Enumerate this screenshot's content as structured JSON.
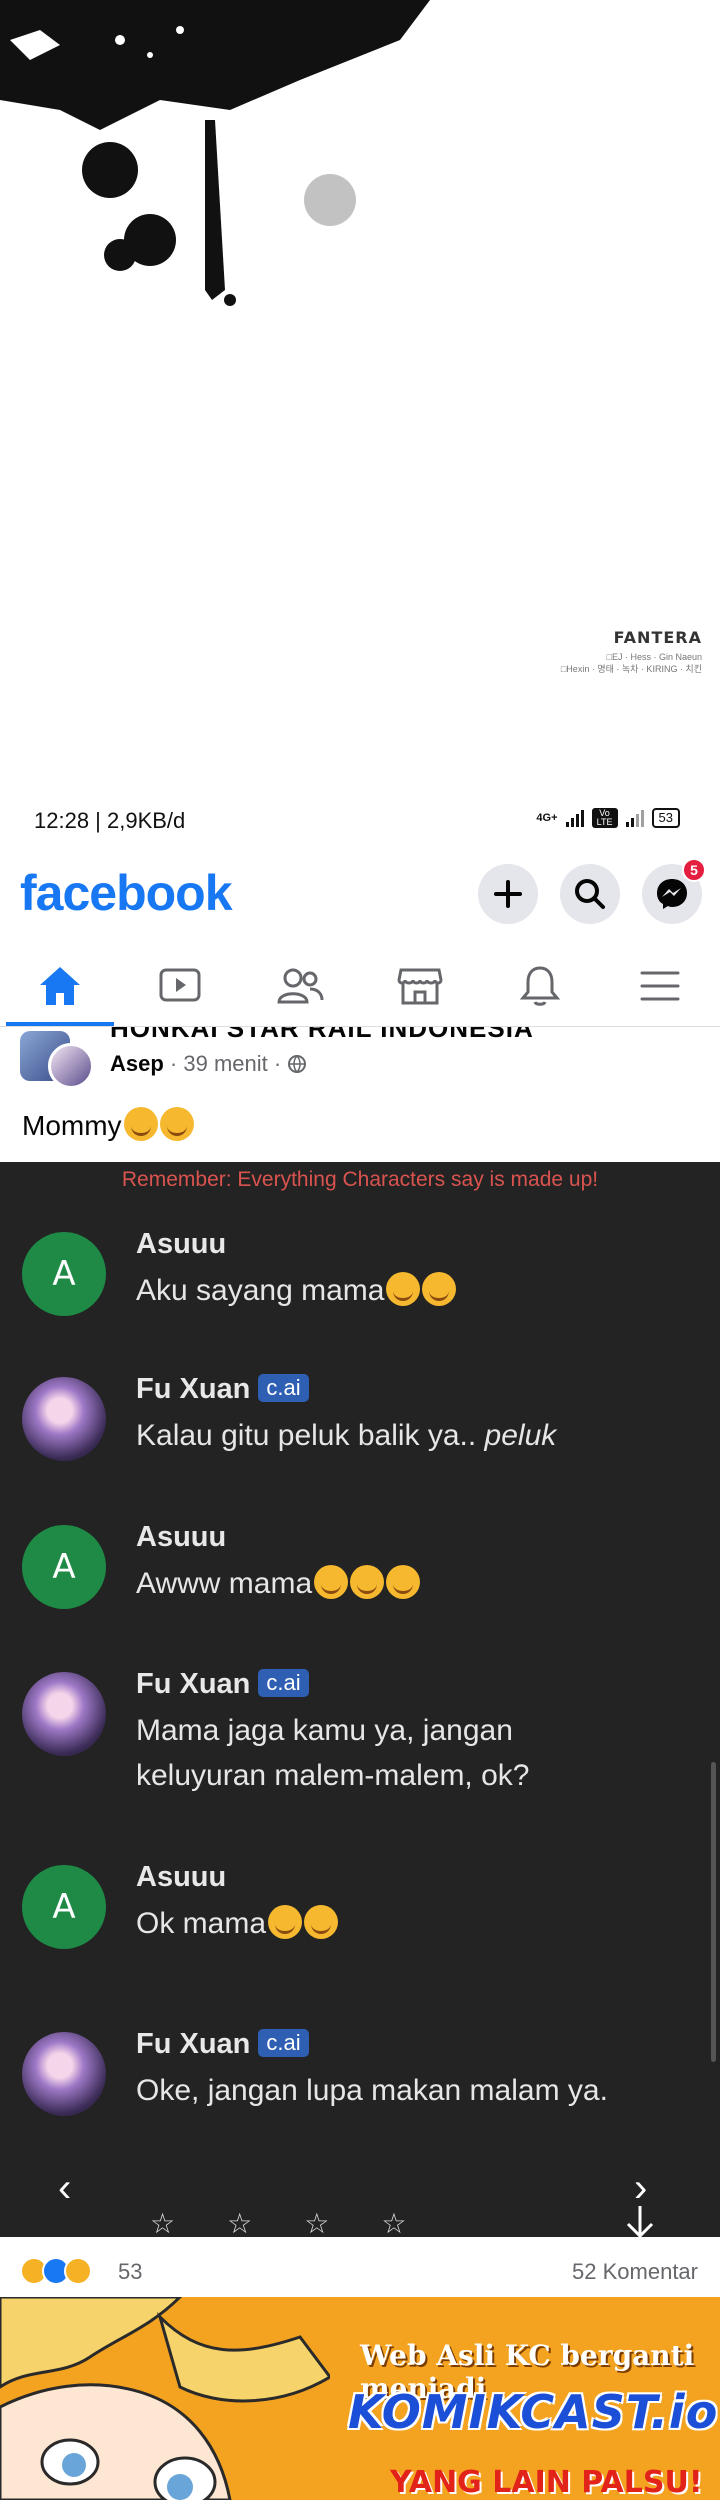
{
  "art": {
    "brand": "FANTERA",
    "credit_line1": "□EJ · Hess · Gin Naeun",
    "credit_line2": "□Hexin · 명태 · 녹차 · KIRING · 치킨"
  },
  "status_bar": {
    "time": "12:28 | 2,9KB/d",
    "network": "4G+",
    "volte": "Vo LTE",
    "battery": "53"
  },
  "facebook": {
    "logo": "facebook",
    "messenger_badge": "5"
  },
  "nav": {
    "items": [
      "home",
      "video",
      "friends",
      "marketplace",
      "notifications",
      "menu"
    ]
  },
  "post": {
    "group_name": "HONKAI STAR RAIL INDONESIA",
    "author": "Asep",
    "time": "39 menit",
    "text": "Mommy"
  },
  "chat": {
    "disclaimer": "Remember: Everything Characters say is made up!",
    "tag": "c.ai",
    "messages": [
      {
        "name": "Asuuu",
        "avatar": "A",
        "text": "Aku sayang mama"
      },
      {
        "name": "Fu Xuan",
        "text": "Kalau gitu peluk balik ya.. ",
        "italic": "peluk"
      },
      {
        "name": "Asuuu",
        "avatar": "A",
        "text": "Awww mama"
      },
      {
        "name": "Fu Xuan",
        "text": "Mama jaga kamu ya, jangan keluyuran malem-malem, ok?"
      },
      {
        "name": "Asuuu",
        "avatar": "A",
        "text": "Ok mama"
      },
      {
        "name": "Fu Xuan",
        "text": "Oke, jangan lupa makan malam ya."
      }
    ],
    "prev": "‹",
    "next": "›",
    "stars": [
      "☆",
      "☆",
      "☆",
      "☆"
    ]
  },
  "reactions": {
    "count": "53",
    "comments": "52 Komentar"
  },
  "banner": {
    "line1": "Web Asli KC berganti menjadi",
    "line2": "KOMIKCAST.io",
    "line3": "YANG LAIN PALSU!"
  }
}
